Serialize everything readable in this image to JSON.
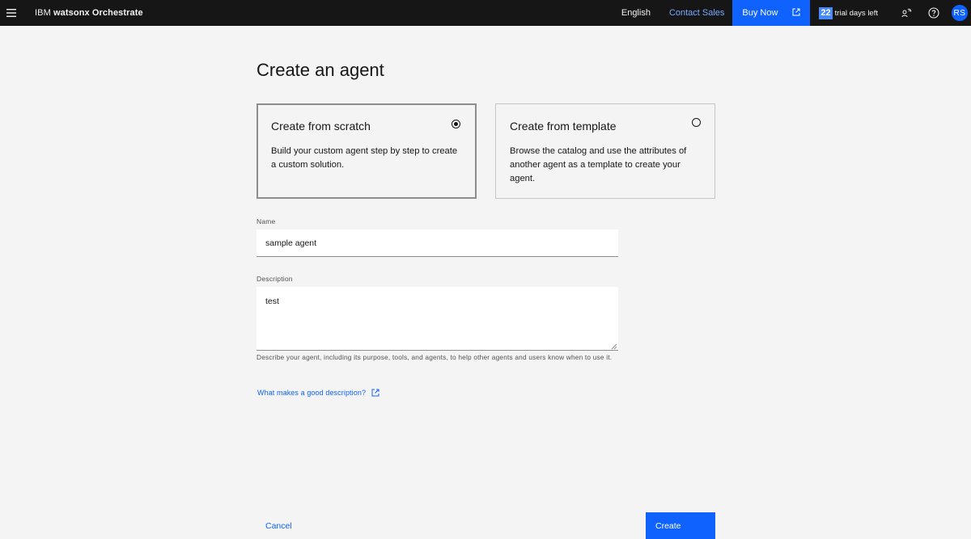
{
  "header": {
    "brand_prefix": "IBM",
    "brand_product": "watsonx Orchestrate",
    "language": "English",
    "contact_sales": "Contact Sales",
    "buy_now": "Buy Now",
    "trial_days": "22",
    "trial_text": "trial days left",
    "avatar_initials": "RS"
  },
  "page": {
    "title": "Create an agent"
  },
  "options": {
    "scratch": {
      "title": "Create from scratch",
      "description": "Build your custom agent step by step to create a custom solution.",
      "selected": true
    },
    "template": {
      "title": "Create from template",
      "description": "Browse the catalog and use the attributes of another agent as a template to create your agent.",
      "selected": false
    }
  },
  "form": {
    "name_label": "Name",
    "name_value": "sample agent",
    "description_label": "Description",
    "description_value": "test",
    "description_helper": "Describe your agent, including its purpose, tools, and agents, to help other agents and users know when to use it.",
    "help_link": "What makes a good description?"
  },
  "footer": {
    "cancel": "Cancel",
    "create": "Create"
  },
  "colors": {
    "header_bg": "#161616",
    "primary": "#0f62fe",
    "link_on_dark": "#78a9ff",
    "page_bg": "#f4f4f4"
  },
  "icons": {
    "menu": "hamburger-menu-icon",
    "launch": "launch-icon",
    "notifications": "user-activity-icon",
    "help": "help-icon",
    "radio_selected": "radio-checked-icon",
    "radio_unselected": "radio-unchecked-icon"
  }
}
